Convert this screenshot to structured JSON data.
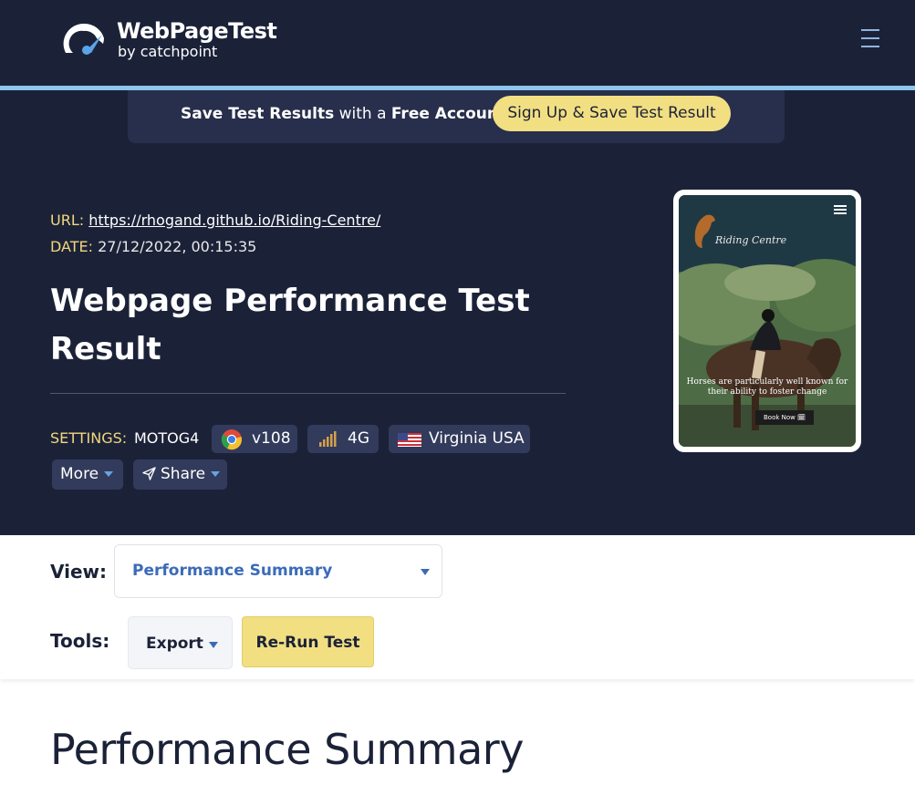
{
  "header": {
    "logo_title": "WebPageTest",
    "logo_subtitle": "by catchpoint",
    "logo_icon": "gauge-icon",
    "menu_icon": "hamburger-menu-icon"
  },
  "banner": {
    "text_bold_1": "Save Test Results",
    "text_mid": " with a ",
    "text_bold_2": "Free Account",
    "signup_label": "Sign Up & Save Test Result"
  },
  "test": {
    "url_label": "URL:",
    "url": "https://rhogand.github.io/Riding-Centre/",
    "date_label": "DATE:",
    "date": "27/12/2022, 00:15:35",
    "title": "Webpage Performance Test Result"
  },
  "settings": {
    "label": "SETTINGS:",
    "device": "MOTOG4",
    "browser_version": "v108",
    "browser_icon": "chrome-icon",
    "network": "4G",
    "network_icon": "signal-bars-icon",
    "location": "Virginia USA",
    "location_icon": "us-flag-icon"
  },
  "actions": {
    "more_label": "More",
    "share_label": "Share",
    "share_icon": "paper-plane-icon"
  },
  "thumbnail": {
    "brand": "Riding Centre",
    "caption": "Horses are particularly well known for their ability to foster change",
    "button": "Book Now 🗓"
  },
  "toolbar": {
    "view_label": "View:",
    "view_value": "Performance Summary",
    "tools_label": "Tools:",
    "export_label": "Export",
    "rerun_label": "Re-Run Test"
  },
  "main": {
    "section_title": "Performance Summary"
  },
  "colors": {
    "navy": "#1b2238",
    "accent_blue": "#8ec5ed",
    "yellow": "#f2df82",
    "label_gold": "#f2d77e",
    "link_blue": "#3b6bb8"
  }
}
